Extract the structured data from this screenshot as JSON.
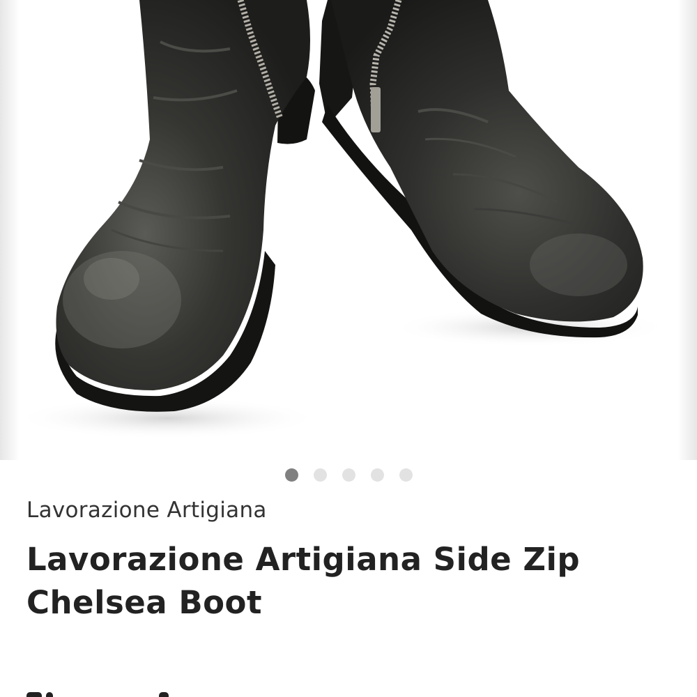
{
  "gallery": {
    "image_alt": "Black leather side zip Chelsea boots",
    "current_index": 0,
    "total_images": 5,
    "dots": [
      {
        "active": true
      },
      {
        "active": false
      },
      {
        "active": false
      },
      {
        "active": false
      },
      {
        "active": false
      }
    ]
  },
  "product": {
    "brand": "Lavorazione Artigiana",
    "title": "Lavorazione Artigiana Side Zip Chelsea Boot"
  },
  "colors": {
    "dot_active": "#808080",
    "dot_inactive": "#e2e2e2",
    "text_primary": "#222222",
    "boot_leather": "#2c2c2a"
  }
}
